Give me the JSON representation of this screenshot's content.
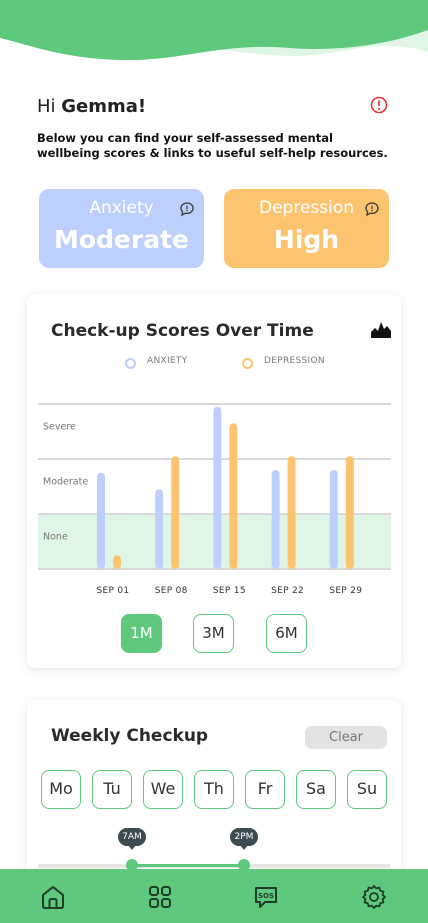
{
  "header": {
    "greeting_prefix": "Hi",
    "user_name": "Gemma!",
    "intro_text": "Below you can find your self-assessed mental wellbeing scores & links to useful self-help resources."
  },
  "scores": [
    {
      "label": "Anxiety",
      "value": "Moderate",
      "color": "#bcd0fb",
      "icon": "chat-icon"
    },
    {
      "label": "Depression",
      "value": "High",
      "color": "#fdc46f",
      "icon": "chat-icon"
    }
  ],
  "chart_panel": {
    "title": "Check-up Scores Over Time",
    "ranges": [
      "1M",
      "3M",
      "6M"
    ],
    "active_range": "1M"
  },
  "chart_data": {
    "type": "bar",
    "categories": [
      "SEP 01",
      "SEP 08",
      "SEP 15",
      "SEP 22",
      "SEP 29"
    ],
    "bands": [
      "None",
      "Moderate",
      "Severe"
    ],
    "ylim": [
      0,
      3
    ],
    "series": [
      {
        "name": "ANXIETY",
        "color": "#bcd0fb",
        "values": [
          1.75,
          1.45,
          2.95,
          1.8,
          1.8
        ]
      },
      {
        "name": "DEPRESSION",
        "color": "#fdc46f",
        "values": [
          0.25,
          2.05,
          2.65,
          2.05,
          2.05
        ]
      }
    ],
    "legend_position": "top-center",
    "grid": true
  },
  "weekly": {
    "title": "Weekly Checkup",
    "clear_label": "Clear",
    "days": [
      "Mo",
      "Tu",
      "We",
      "Th",
      "Fr",
      "Sa",
      "Su"
    ],
    "time_start": "7AM",
    "time_end": "2PM"
  },
  "nav": {
    "items": [
      "home-icon",
      "grid-icon",
      "sos-icon",
      "settings-icon"
    ],
    "sos_text": "SOS"
  },
  "colors": {
    "accent_green": "#5ec97d",
    "anxiety_blue": "#bcd0fb",
    "depression_orange": "#fdc46f",
    "alert_red": "#e53935"
  }
}
